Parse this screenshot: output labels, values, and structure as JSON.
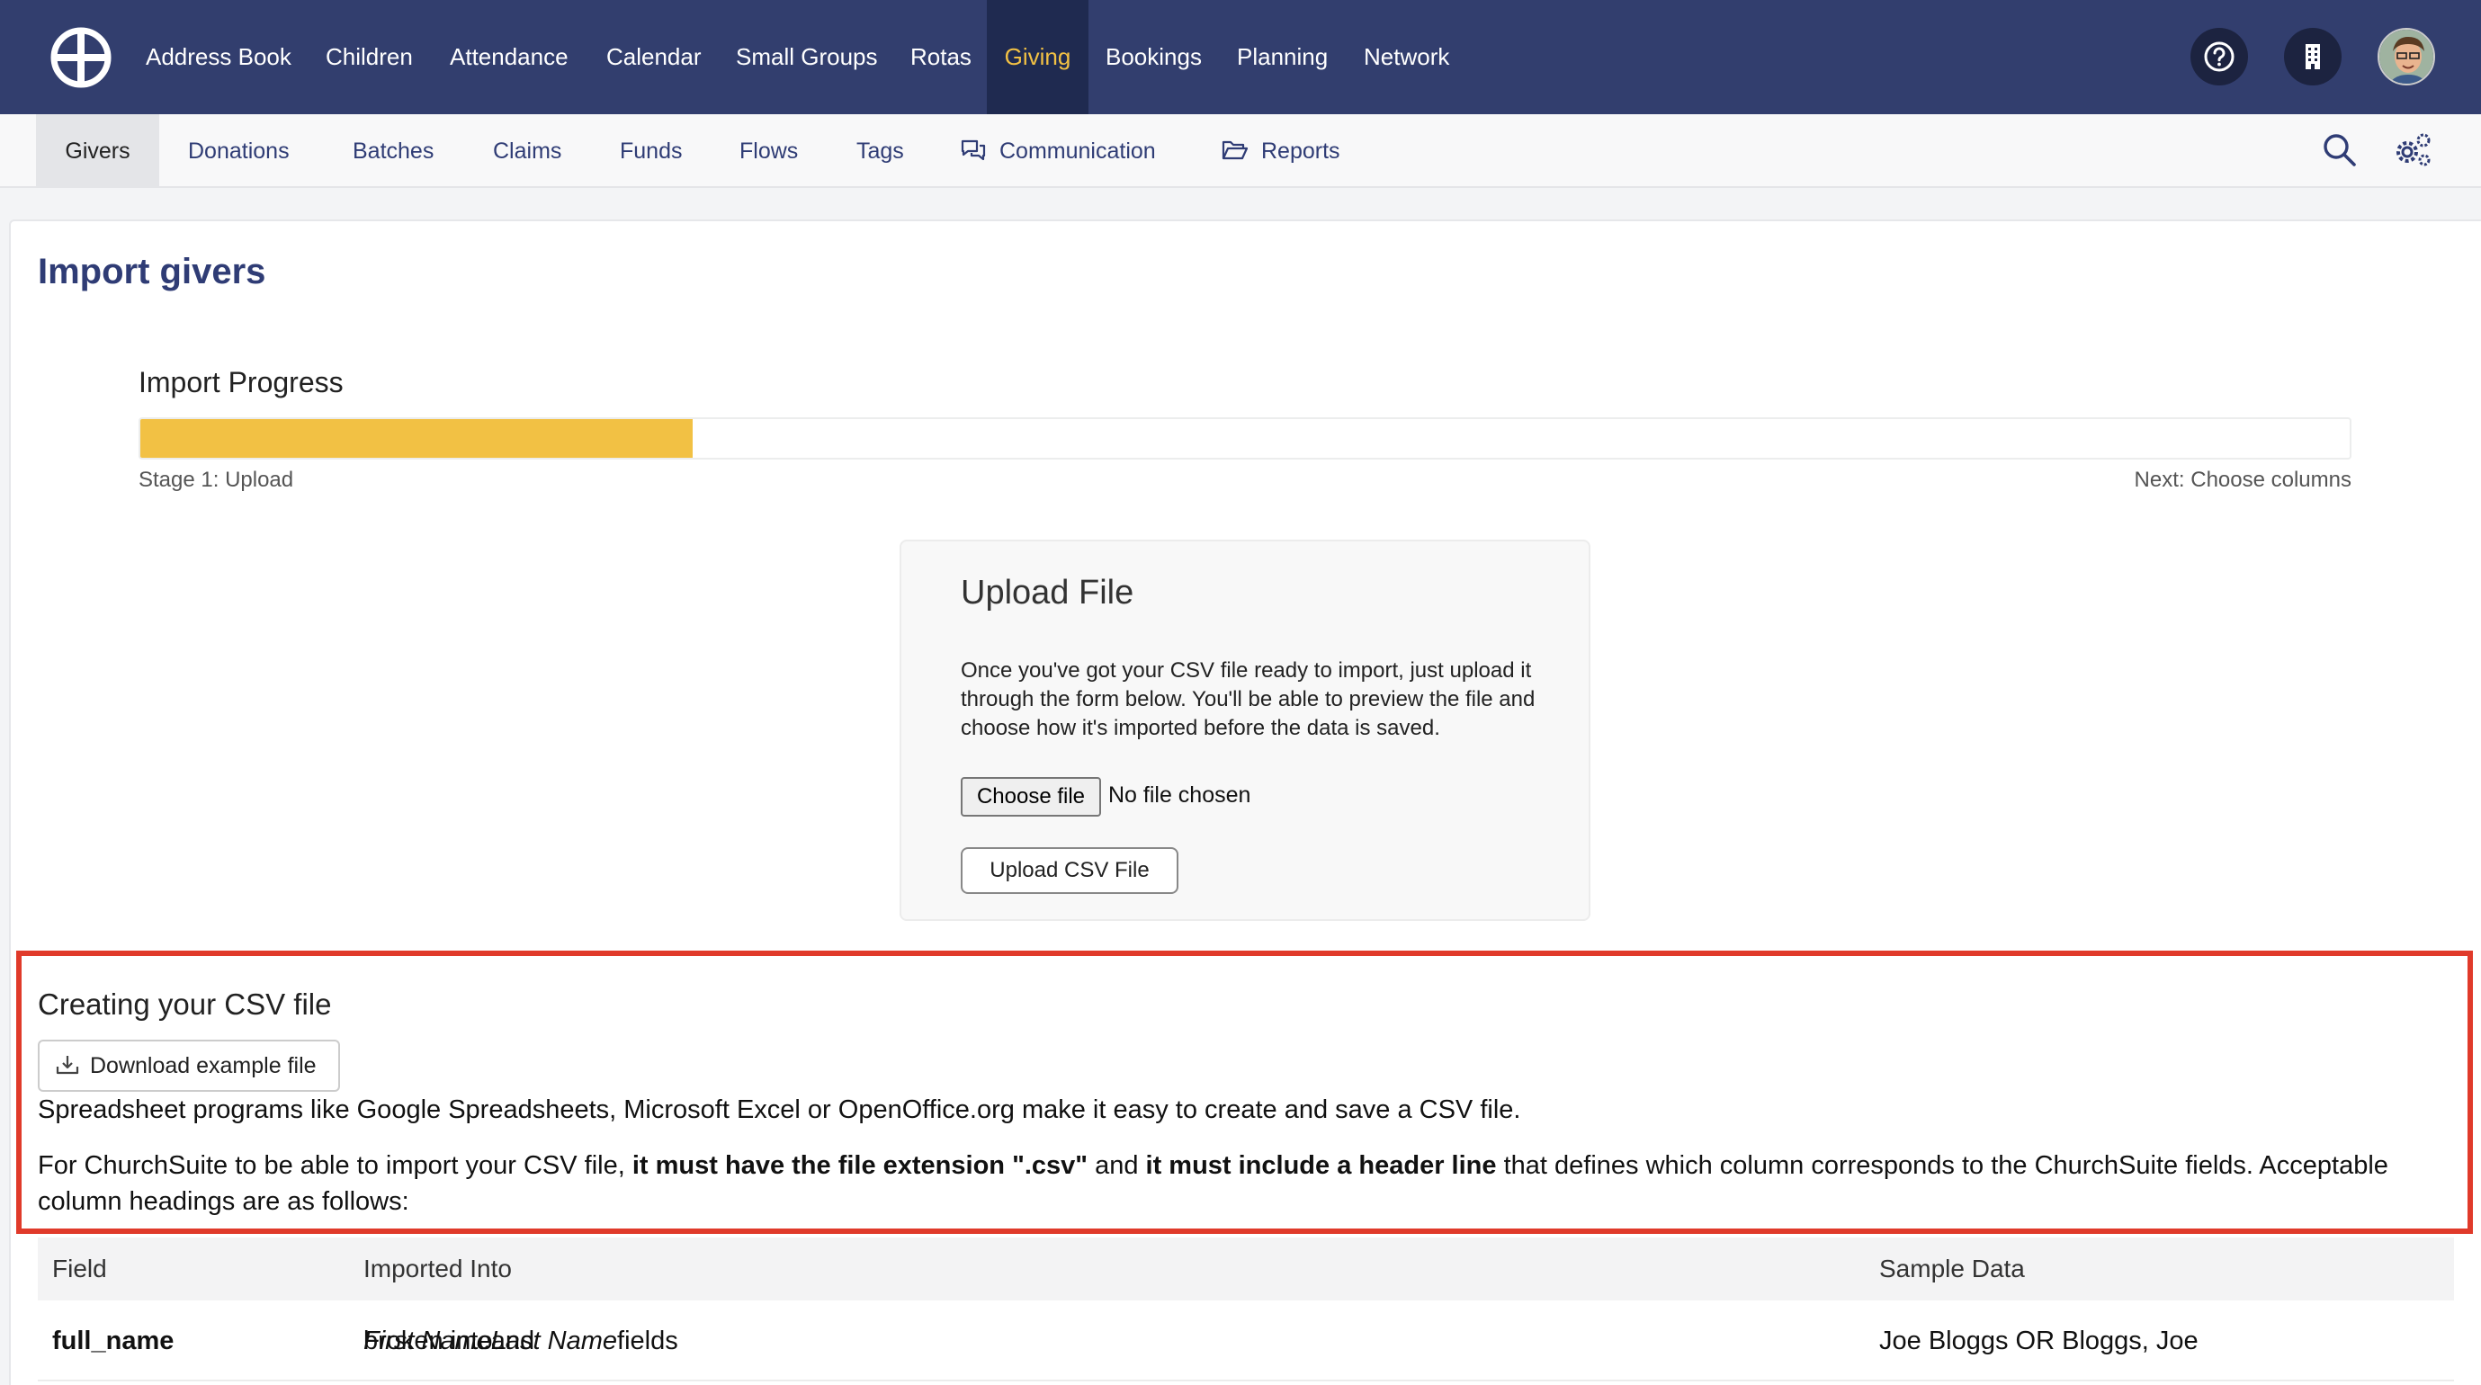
{
  "topnav": {
    "items": [
      "Address Book",
      "Children",
      "Attendance",
      "Calendar",
      "Small Groups",
      "Rotas",
      "Giving",
      "Bookings",
      "Planning",
      "Network"
    ],
    "active": "Giving",
    "icons": [
      "help-icon",
      "building-icon"
    ]
  },
  "subnav": {
    "items": [
      "Givers",
      "Donations",
      "Batches",
      "Claims",
      "Funds",
      "Flows",
      "Tags",
      "Communication",
      "Reports"
    ],
    "active": "Givers"
  },
  "page": {
    "title": "Import givers"
  },
  "progress": {
    "label": "Import Progress",
    "value_fraction": 0.25,
    "stage": "Stage 1: Upload",
    "next": "Next: Choose columns",
    "color": "#f2c144"
  },
  "upload": {
    "title": "Upload File",
    "description": "Once you've got your CSV file ready to import, just upload it through the form below. You'll be able to preview the file and choose how it's imported before the data is saved.",
    "choose_label": "Choose file",
    "no_file": "No file chosen",
    "submit_label": "Upload CSV File"
  },
  "csv": {
    "title": "Creating your CSV file",
    "download_label": "Download example file",
    "para1": "Spreadsheet programs like Google Spreadsheets, Microsoft Excel or OpenOffice.org make it easy to create and save a CSV file.",
    "para2_a": "For ChurchSuite to be able to import your CSV file, ",
    "para2_b": "it must have the file extension \".csv\"",
    "para2_c": " and ",
    "para2_d": "it must include a header line",
    "para2_e": " that defines which column corresponds to the ChurchSuite fields. Acceptable column headings are as follows:"
  },
  "table": {
    "headers": [
      "Field",
      "Imported Into",
      "Sample Data"
    ],
    "rows": [
      {
        "field": "full_name",
        "into_a": "broken into ",
        "into_b": "First Name",
        "into_c": " and ",
        "into_d": "Last Name",
        "into_e": " fields",
        "sample": "Joe Bloggs OR Bloggs, Joe"
      }
    ]
  },
  "colors": {
    "nav_bg": "#323e6e",
    "nav_active_bg": "#1f2a50",
    "accent": "#f2c144",
    "link": "#2f3c75",
    "highlight": "#e03a2a"
  }
}
